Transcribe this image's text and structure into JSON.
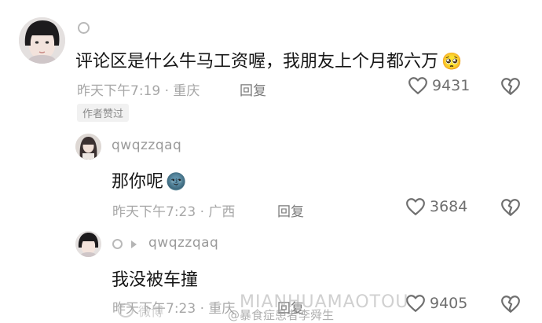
{
  "comments": [
    {
      "text": "评论区是什么牛马工资喔，我朋友上个月都六万",
      "emoji": "🥺",
      "time": "昨天下午7:19",
      "location": "重庆",
      "reply_label": "回复",
      "likes": "9431",
      "badge": "作者赞过"
    },
    {
      "username": "qwqzzqaq",
      "text": "那你呢",
      "emoji": "🌚",
      "time": "昨天下午7:23",
      "location": "广西",
      "reply_label": "回复",
      "likes": "3684"
    },
    {
      "username": "qwqzzqaq",
      "text": "我没被车撞",
      "time": "昨天下午7:23",
      "location": "重庆",
      "reply_label": "回复",
      "likes": "9405"
    }
  ],
  "watermark": {
    "left": "微博",
    "handle": "@暴食症患者李舜生",
    "overlay": "MIANHUAMAOTOU"
  },
  "icons": {
    "like": "heart-outline-icon",
    "dislike": "broken-heart-icon",
    "arrow": "play-arrow-icon",
    "status": "circle-ring-icon"
  }
}
